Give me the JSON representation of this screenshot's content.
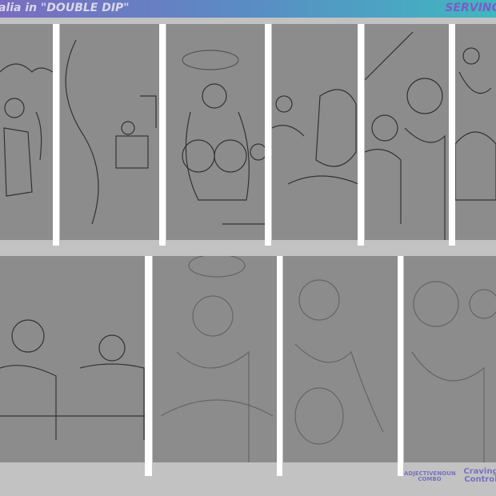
{
  "header": {
    "title": "alia in \"DOUBLE DIP\"",
    "right_text": "SERVING",
    "colors": {
      "start": "#7a6cc0",
      "end": "#3fb8c0"
    }
  },
  "logos": {
    "left": "ADJECTIVENOUN COMBO",
    "right": "Craving Control"
  }
}
